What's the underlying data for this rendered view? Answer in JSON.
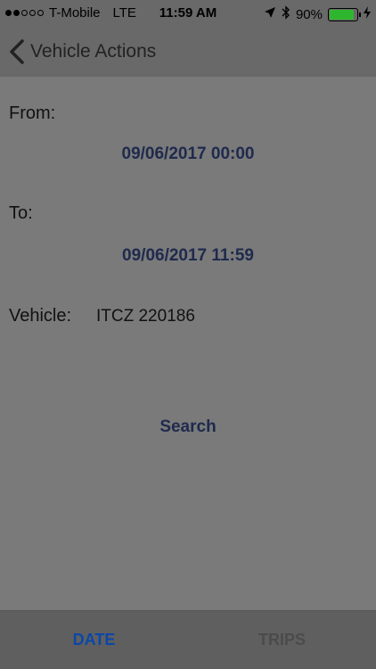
{
  "status_bar": {
    "carrier": "T-Mobile",
    "network": "LTE",
    "time": "11:59 AM",
    "battery_percent": "90%",
    "battery_level": 0.9,
    "icons": [
      "location-arrow-icon",
      "bluetooth-icon",
      "battery-icon",
      "charging-bolt-icon"
    ],
    "signal_strength_of_5": 2
  },
  "nav": {
    "title": "Vehicle Actions",
    "back_icon": "chevron-left-icon"
  },
  "form": {
    "from_label": "From:",
    "from_value": "09/06/2017 00:00",
    "to_label": "To:",
    "to_value": "09/06/2017 11:59",
    "vehicle_label": "Vehicle:",
    "vehicle_value": "ITCZ 220186",
    "search_label": "Search"
  },
  "tabs": [
    {
      "label": "DATE",
      "active": true
    },
    {
      "label": "TRIPS",
      "active": false
    }
  ],
  "colors": {
    "accent": "#1f2a4d",
    "active_tab": "#0b47a8",
    "inactive_tab": "#4b4b4b",
    "battery": "#2fb62f"
  }
}
